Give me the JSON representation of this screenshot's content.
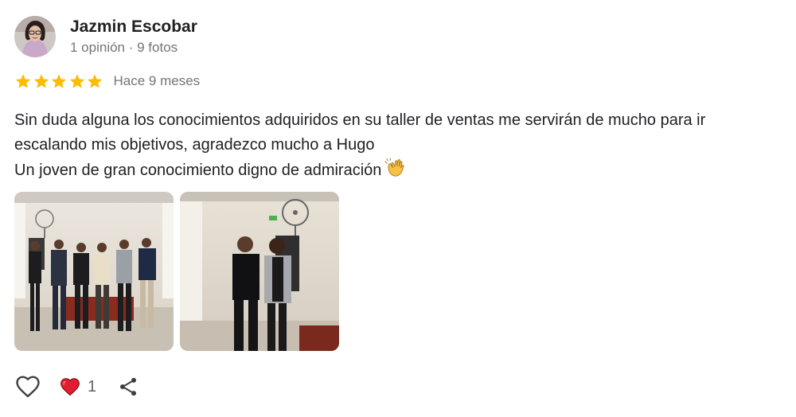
{
  "author": {
    "name": "Jazmin Escobar",
    "meta": "1 opinión · 9 fotos"
  },
  "rating": {
    "stars": 5,
    "time_ago": "Hace 9 meses",
    "star_color": "#fbbc04"
  },
  "review": {
    "line1": "Sin duda alguna los conocimientos adquiridos en su taller de ventas me servirán de mucho para ir",
    "line2": "escalando mis objetivos, agradezco mucho a Hugo",
    "line3": "Un joven de gran conocimiento digno de admiración"
  },
  "photos": [
    {
      "icon": "group-photo"
    },
    {
      "icon": "couple-photo"
    }
  ],
  "actions": {
    "like_icon": "heart-outline-icon",
    "reaction_icon": "red-heart-icon",
    "reaction_count": "1",
    "share_icon": "share-icon",
    "heart_color": "#e53935"
  }
}
